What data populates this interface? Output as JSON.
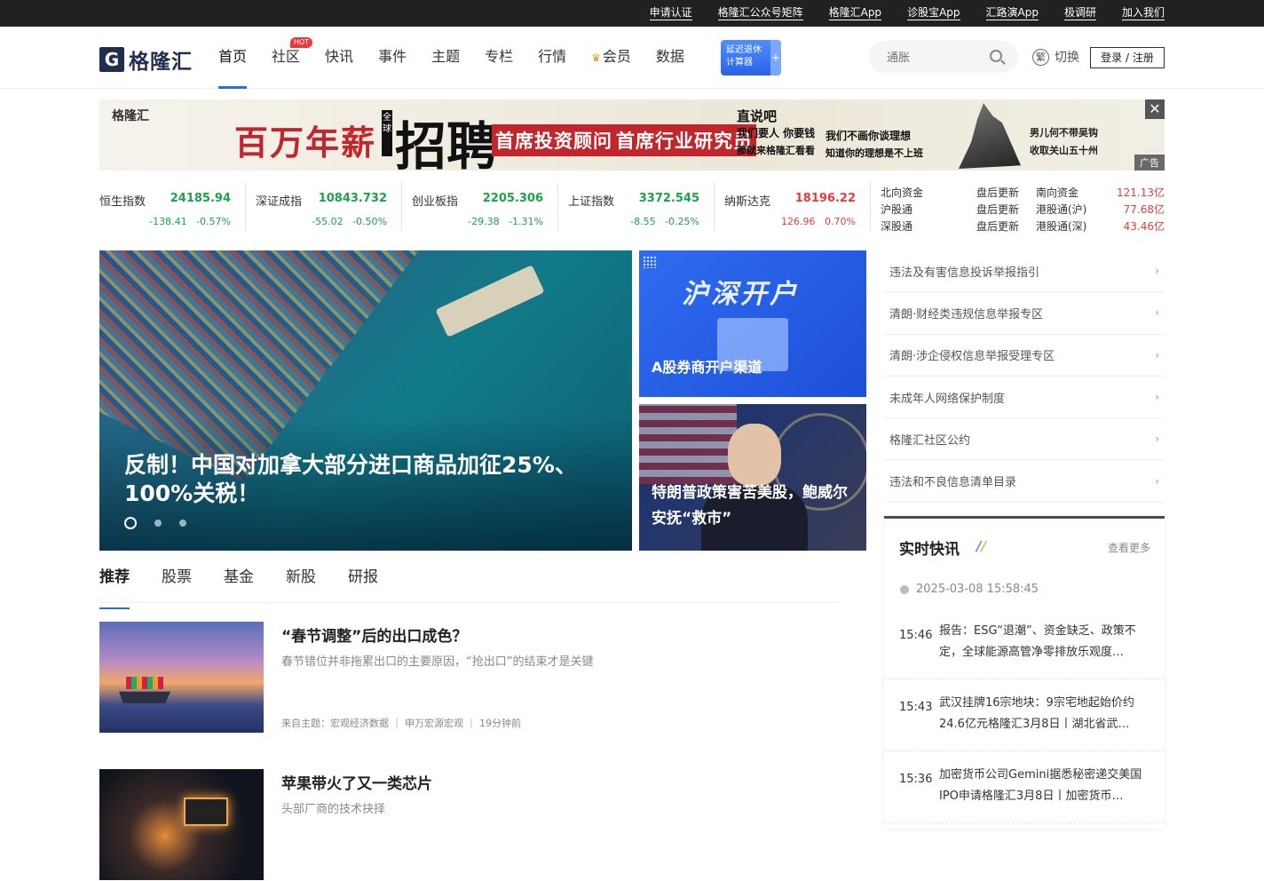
{
  "topbar": {
    "links": [
      "申请认证",
      "格隆汇公众号矩阵",
      "格隆汇App",
      "诊股宝App",
      "汇路演App",
      "极调研",
      "加入我们"
    ]
  },
  "header": {
    "logo_mark": "G",
    "logo_text": "格隆汇",
    "nav": [
      {
        "label": "首页",
        "active": true
      },
      {
        "label": "社区",
        "badge": "HOT"
      },
      {
        "label": "快讯"
      },
      {
        "label": "事件"
      },
      {
        "label": "主题"
      },
      {
        "label": "专栏"
      },
      {
        "label": "行情"
      },
      {
        "label": "会员",
        "icon": "crown-icon"
      },
      {
        "label": "数据"
      }
    ],
    "calculator": {
      "line1": "延迟退休",
      "line2": "计算器",
      "plus": "+"
    },
    "search_placeholder": "通胀",
    "switch_icon": "繁",
    "switch_label": "切换",
    "login_label": "登录 / 注册"
  },
  "banner": {
    "logo": "格隆汇",
    "headline": "百万年薪",
    "global": "全球",
    "recruit": "招聘",
    "tag1": "首席投资顾问",
    "tag2": "首席行业研究员",
    "slogan1_a": "直说吧",
    "slogan1_b": "我们要人 你要钱",
    "slogan1_c": "那就来格隆汇看看",
    "slogan2_a": "我们不画你谈理想",
    "slogan2_b": "知道你的理想是不上班",
    "poem_a": "男儿何不带吴钩",
    "poem_b": "收取关山五十州",
    "ad_label": "广告",
    "close": "✕"
  },
  "indices": [
    {
      "name": "恒生指数",
      "price": "24185.94",
      "change": "-138.41",
      "pct": "-0.57%",
      "dir": "down"
    },
    {
      "name": "深证成指",
      "price": "10843.732",
      "change": "-55.02",
      "pct": "-0.50%",
      "dir": "down"
    },
    {
      "name": "创业板指",
      "price": "2205.306",
      "change": "-29.38",
      "pct": "-1.31%",
      "dir": "down"
    },
    {
      "name": "上证指数",
      "price": "3372.545",
      "change": "-8.55",
      "pct": "-0.25%",
      "dir": "down"
    },
    {
      "name": "纳斯达克",
      "price": "18196.22",
      "change": "126.96",
      "pct": "0.70%",
      "dir": "up"
    }
  ],
  "northbound": [
    {
      "label": "北向资金",
      "value": "盘后更新"
    },
    {
      "label": "沪股通",
      "value": "盘后更新"
    },
    {
      "label": "深股通",
      "value": "盘后更新"
    }
  ],
  "southbound": [
    {
      "label": "南向资金",
      "value": "121.13亿"
    },
    {
      "label": "港股通(沪)",
      "value": "77.68亿"
    },
    {
      "label": "港股通(深)",
      "value": "43.46亿"
    }
  ],
  "hero": {
    "title": "反制！中国对加拿大部分进口商品加征25%、100%关税！"
  },
  "side_cards": {
    "card1_big": "沪深开户",
    "card1_caption": "A股券商开户渠道",
    "card2_caption": "特朗普政策害苦美股，鲍威尔安抚“救市”"
  },
  "links": [
    "违法及有害信息投诉举报指引",
    "清朗·财经类违规信息举报专区",
    "清朗·涉企侵权信息举报受理专区",
    "未成年人网络保护制度",
    "格隆汇社区公约",
    "违法和不良信息清单目录"
  ],
  "flash": {
    "title": "实时快讯",
    "more": "查看更多",
    "date": "2025-03-08 15:58:45",
    "items": [
      {
        "time": "15:46",
        "text": "报告：ESG“退潮”、资金缺乏、政策不定，全球能源高管净零排放乐观度…"
      },
      {
        "time": "15:43",
        "text": "武汉挂牌16宗地块：9宗宅地起始价约24.6亿元格隆汇3月8日丨湖北省武…"
      },
      {
        "time": "15:36",
        "text": "加密货币公司Gemini据悉秘密递交美国IPO申请格隆汇3月8日丨加密货币…"
      }
    ]
  },
  "tabs": [
    "推荐",
    "股票",
    "基金",
    "新股",
    "研报"
  ],
  "articles": [
    {
      "title": "“春节调整”后的出口成色？",
      "desc": "春节错位并非拖累出口的主要原因，“抢出口”的结束才是关键",
      "meta": "来自主题：宏观经济数据 ｜ 申万宏源宏观 ｜ 19分钟前"
    },
    {
      "title": "苹果带火了又一类芯片",
      "desc": "头部厂商的技术抉择",
      "meta": ""
    }
  ]
}
